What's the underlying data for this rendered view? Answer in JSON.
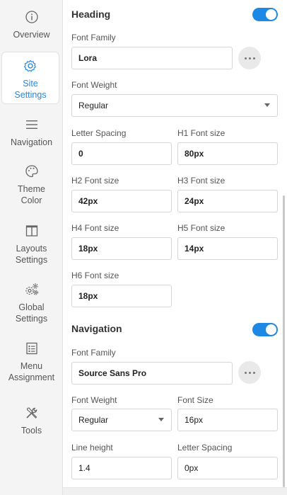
{
  "sidebar": {
    "items": [
      {
        "label": "Overview",
        "icon": "info-icon"
      },
      {
        "label": "Site\nSettings",
        "icon": "gear-icon"
      },
      {
        "label": "Navigation",
        "icon": "menu-icon"
      },
      {
        "label": "Theme\nColor",
        "icon": "palette-icon"
      },
      {
        "label": "Layouts\nSettings",
        "icon": "layout-icon"
      },
      {
        "label": "Global\nSettings",
        "icon": "gears-icon"
      },
      {
        "label": "Menu\nAssignment",
        "icon": "list-icon"
      },
      {
        "label": "Tools",
        "icon": "tools-icon"
      }
    ],
    "active_color": "#1e88e5"
  },
  "heading": {
    "title": "Heading",
    "enabled": true,
    "font_family_label": "Font Family",
    "font_family": "Lora",
    "font_weight_label": "Font Weight",
    "font_weight": "Regular",
    "letter_spacing_label": "Letter Spacing",
    "letter_spacing": "0",
    "h1_label": "H1 Font size",
    "h1": "80px",
    "h2_label": "H2 Font size",
    "h2": "42px",
    "h3_label": "H3 Font size",
    "h3": "24px",
    "h4_label": "H4 Font size",
    "h4": "18px",
    "h5_label": "H5 Font size",
    "h5": "14px",
    "h6_label": "H6 Font size",
    "h6": "18px"
  },
  "navigation": {
    "title": "Navigation",
    "enabled": true,
    "font_family_label": "Font Family",
    "font_family": "Source Sans Pro",
    "font_weight_label": "Font Weight",
    "font_weight": "Regular",
    "font_size_label": "Font Size",
    "font_size": "16px",
    "line_height_label": "Line height",
    "line_height": "1.4",
    "letter_spacing_label": "Letter Spacing",
    "letter_spacing": "0px"
  },
  "colors": {
    "accent": "#1e88e5",
    "sidebar_bg": "#f4f4f4"
  }
}
